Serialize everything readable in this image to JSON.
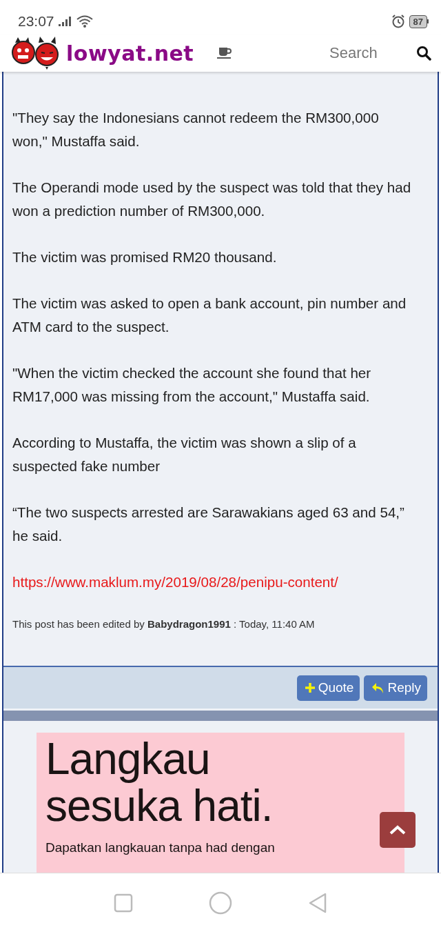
{
  "status_bar": {
    "time": "23:07",
    "battery": "87"
  },
  "header": {
    "logo": "lowyat.net",
    "search": {
      "placeholder": "Search"
    }
  },
  "post": {
    "paragraphs": [
      "\"They say the Indonesians cannot redeem the RM300,000 won,\" Mustaffa said.",
      "The Operandi mode used by the suspect was told that they had won a prediction number of RM300,000.",
      "The victim was promised RM20 thousand.",
      "The victim was asked to open a bank account, pin number and ATM card to the suspect.",
      "\"When the victim checked the account she found that her RM17,000 was missing from the account,\" Mustaffa said.",
      "According to Mustaffa, the victim was shown a slip of a suspected fake number",
      "“The two suspects arrested are Sarawakians aged 63 and 54,” he said."
    ],
    "link": "https://www.maklum.my/2019/08/28/penipu-content/",
    "edit_note": "This post has been edited by **Babydragon1991** : Today, 11:40 AM"
  },
  "actions": [
    {
      "kind": "quote",
      "label": "Quote"
    },
    {
      "kind": "reply",
      "label": "Reply"
    }
  ],
  "ad": {
    "headline_lines": [
      "Langkau",
      "sesuka hati."
    ],
    "body": "Dapatkan langkauan tanpa had dengan"
  }
}
